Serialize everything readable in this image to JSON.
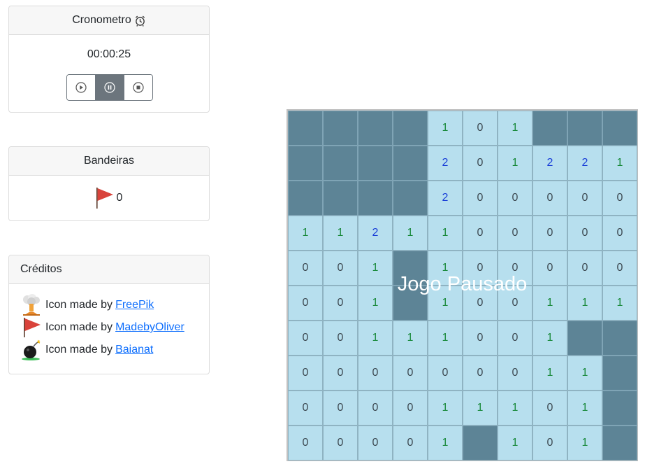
{
  "timer": {
    "title": "Cronometro",
    "title_icon": "alarm-clock-icon",
    "value": "00:00:25",
    "buttons": [
      {
        "name": "play-button",
        "icon": "play-icon",
        "active": false
      },
      {
        "name": "pause-button",
        "icon": "pause-icon",
        "active": true
      },
      {
        "name": "stop-button",
        "icon": "stop-icon",
        "active": false
      }
    ]
  },
  "flags": {
    "title": "Bandeiras",
    "icon": "red-flag-icon",
    "count": "0"
  },
  "credits": {
    "title": "Créditos",
    "prefix": "Icon made by",
    "items": [
      {
        "icon": "explosion-icon",
        "author": "FreePik"
      },
      {
        "icon": "red-flag-icon",
        "author": "MadebyOliver"
      },
      {
        "icon": "bomb-icon",
        "author": "Baianat"
      }
    ]
  },
  "board": {
    "overlay_text": "Jogo Pausado",
    "colors": {
      "open": "#b7dfee",
      "closed": "#5d8496",
      "one": "#1a8a3c",
      "two": "#1a3fd8"
    },
    "rows": [
      [
        "#",
        "#",
        "#",
        "#",
        "1",
        "0",
        "1",
        "#",
        "#",
        "#"
      ],
      [
        "#",
        "#",
        "#",
        "#",
        "2",
        "0",
        "1",
        "2",
        "2",
        "1"
      ],
      [
        "#",
        "#",
        "#",
        "#",
        "2",
        "0",
        "0",
        "0",
        "0",
        "0"
      ],
      [
        "1",
        "1",
        "2",
        "1",
        "1",
        "0",
        "0",
        "0",
        "0",
        "0"
      ],
      [
        "0",
        "0",
        "1",
        "#",
        "1",
        "0",
        "0",
        "0",
        "0",
        "0"
      ],
      [
        "0",
        "0",
        "1",
        "#",
        "1",
        "0",
        "0",
        "1",
        "1",
        "1"
      ],
      [
        "0",
        "0",
        "1",
        "1",
        "1",
        "0",
        "0",
        "1",
        "#",
        "#"
      ],
      [
        "0",
        "0",
        "0",
        "0",
        "0",
        "0",
        "0",
        "1",
        "1",
        "#"
      ],
      [
        "0",
        "0",
        "0",
        "0",
        "1",
        "1",
        "1",
        "0",
        "1",
        "#"
      ],
      [
        "0",
        "0",
        "0",
        "0",
        "1",
        "#",
        "1",
        "0",
        "1",
        "#"
      ]
    ]
  }
}
